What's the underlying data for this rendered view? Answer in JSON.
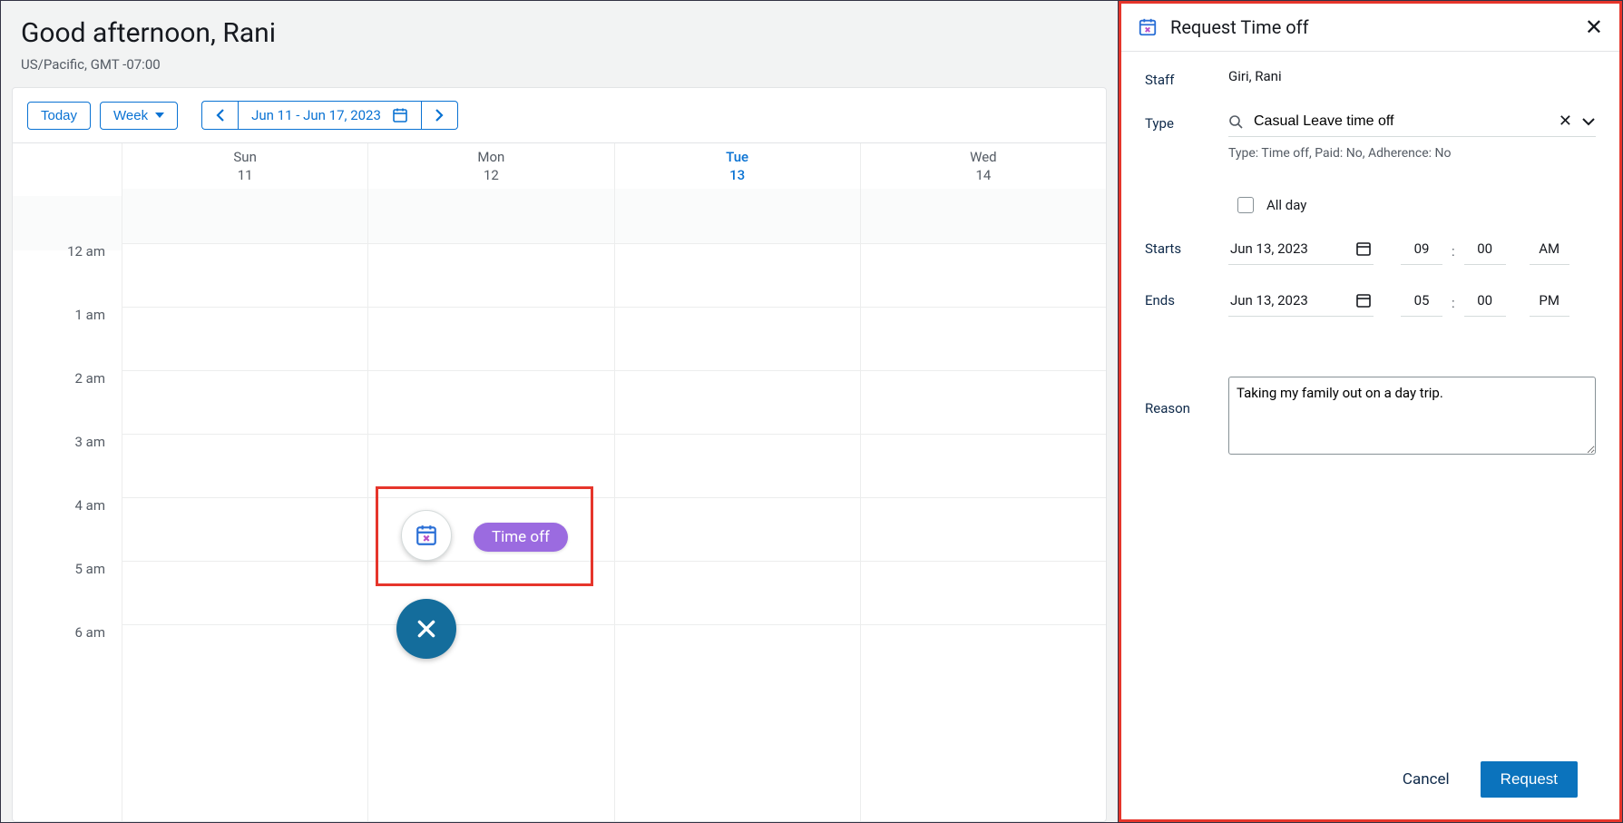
{
  "header": {
    "greeting": "Good afternoon, Rani",
    "timezone": "US/Pacific, GMT -07:00"
  },
  "toolbar": {
    "today": "Today",
    "view": "Week",
    "range": "Jun 11 - Jun 17, 2023"
  },
  "days": [
    {
      "dow": "Sun",
      "num": "11",
      "current": false
    },
    {
      "dow": "Mon",
      "num": "12",
      "current": false
    },
    {
      "dow": "Tue",
      "num": "13",
      "current": true
    },
    {
      "dow": "Wed",
      "num": "14",
      "current": false
    }
  ],
  "hours": [
    "12 am",
    "1 am",
    "2 am",
    "3 am",
    "4 am",
    "5 am",
    "6 am"
  ],
  "popover": {
    "timeoff_label": "Time off"
  },
  "panel": {
    "title": "Request Time off",
    "labels": {
      "staff": "Staff",
      "type": "Type",
      "starts": "Starts",
      "ends": "Ends",
      "reason": "Reason",
      "allday": "All day"
    },
    "staffValue": "Giri, Rani",
    "typeValue": "Casual Leave time off",
    "typeSub": "Type: Time off, Paid: No, Adherence: No",
    "starts": {
      "date": "Jun 13, 2023",
      "hh": "09",
      "mm": "00",
      "ap": "AM"
    },
    "ends": {
      "date": "Jun 13, 2023",
      "hh": "05",
      "mm": "00",
      "ap": "PM"
    },
    "reasonValue": "Taking my family out on a day trip.",
    "cancel": "Cancel",
    "request": "Request"
  }
}
